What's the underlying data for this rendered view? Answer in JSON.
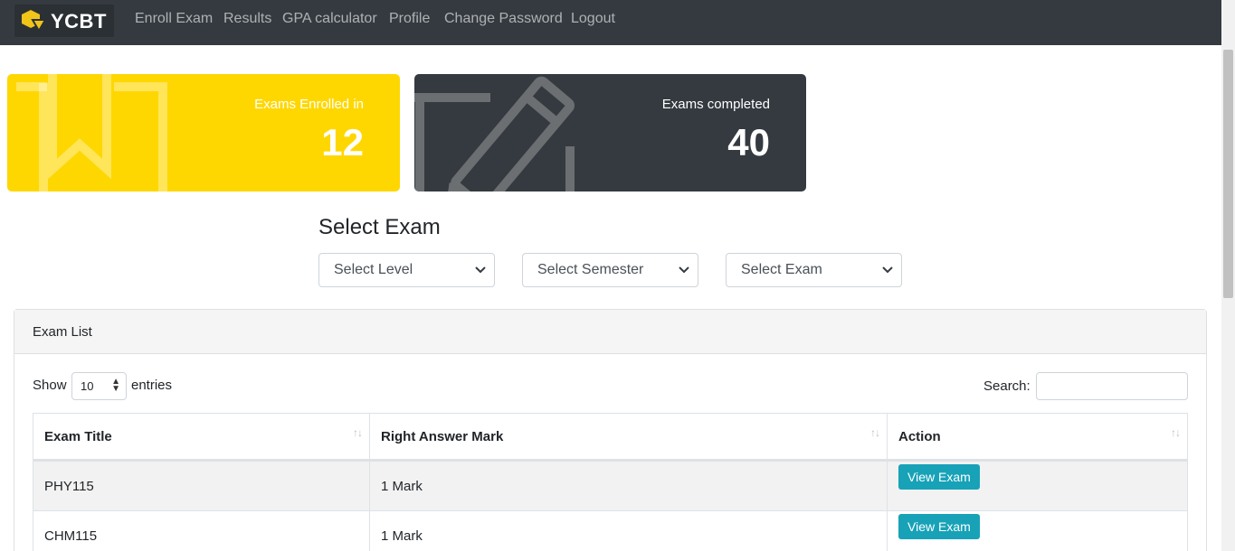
{
  "navbar": {
    "brand": "YCBT",
    "brand_icon": "logo-icon",
    "links": [
      "Enroll Exam",
      "Results",
      "GPA calculator",
      "Profile",
      "Change Password",
      "Logout"
    ]
  },
  "stats": {
    "enrolled": {
      "label": "Exams Enrolled in",
      "value": "12",
      "icon": "bookmark-icon",
      "color": "#ffd700"
    },
    "completed": {
      "label": "Exams completed",
      "value": "40",
      "icon": "pencil-icon",
      "color": "#343a40"
    }
  },
  "select_exam": {
    "title": "Select Exam",
    "level": "Select Level",
    "semester": "Select Semester",
    "exam": "Select Exam"
  },
  "exam_list": {
    "header": "Exam List",
    "show_label": "Show",
    "entries_value": "10",
    "entries_label": "entries",
    "search_label": "Search:",
    "columns": [
      "Exam Title",
      "Right Answer Mark",
      "Action"
    ],
    "rows": [
      {
        "title": "PHY115",
        "mark": "1 Mark",
        "action": "View Exam"
      },
      {
        "title": "CHM115",
        "mark": "1 Mark",
        "action": "View Exam"
      }
    ]
  },
  "colors": {
    "accent": "#17a2b8",
    "navbar": "#343a40",
    "yellow": "#ffd700"
  }
}
